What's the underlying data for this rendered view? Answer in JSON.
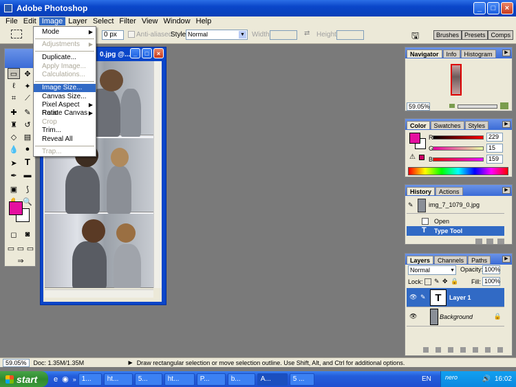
{
  "window": {
    "title": "Adobe Photoshop",
    "min": "_",
    "max": "□",
    "close": "×"
  },
  "menubar": [
    "File",
    "Edit",
    "Image",
    "Layer",
    "Select",
    "Filter",
    "View",
    "Window",
    "Help"
  ],
  "options": {
    "feather_value": "0 px",
    "anti_aliased": "Anti-aliased",
    "style_label": "Style:",
    "style_value": "Normal",
    "width_label": "Width:",
    "height_label": "Height:"
  },
  "palette_well": [
    "Brushes",
    "Presets",
    "Comps"
  ],
  "image_menu": {
    "items": [
      {
        "label": "Mode",
        "sub": true,
        "disabled": false
      },
      {
        "label": "Adjustments",
        "sub": true,
        "disabled": true
      },
      {
        "label": "Duplicate...",
        "sub": false,
        "disabled": false
      },
      {
        "label": "Apply Image...",
        "sub": false,
        "disabled": true
      },
      {
        "label": "Calculations...",
        "sub": false,
        "disabled": true
      },
      {
        "label": "Image Size...",
        "sub": false,
        "disabled": false,
        "highlighted": true
      },
      {
        "label": "Canvas Size...",
        "sub": false,
        "disabled": false
      },
      {
        "label": "Pixel Aspect Ratio",
        "sub": true,
        "disabled": false
      },
      {
        "label": "Rotate Canvas",
        "sub": true,
        "disabled": false
      },
      {
        "label": "Crop",
        "sub": false,
        "disabled": true
      },
      {
        "label": "Trim...",
        "sub": false,
        "disabled": false
      },
      {
        "label": "Reveal All",
        "sub": false,
        "disabled": false
      },
      {
        "label": "Trap...",
        "sub": false,
        "disabled": true
      }
    ]
  },
  "document": {
    "title": "0.jpg @..."
  },
  "navigator": {
    "tabs": [
      "Navigator",
      "Info",
      "Histogram"
    ],
    "zoom": "59.05%"
  },
  "color": {
    "tabs": [
      "Color",
      "Swatches",
      "Styles"
    ],
    "r_label": "R",
    "g_label": "G",
    "b_label": "B",
    "r": "229",
    "g": "15",
    "b": "159",
    "foreground": "#e50f9f"
  },
  "history": {
    "tabs": [
      "History",
      "Actions"
    ],
    "snapshot": "img_7_1079_0.jpg",
    "items": [
      "Open",
      "Type Tool"
    ]
  },
  "layers": {
    "tabs": [
      "Layers",
      "Channels",
      "Paths"
    ],
    "blend": "Normal",
    "opacity_label": "Opacity:",
    "opacity": "100%",
    "lock_label": "Lock:",
    "fill_label": "Fill:",
    "fill": "100%",
    "items": [
      {
        "name": "Layer 1",
        "thumb": "T",
        "selected": true
      },
      {
        "name": "Background",
        "thumb": "",
        "selected": false
      }
    ]
  },
  "status": {
    "zoom": "59.05%",
    "doc": "Doc: 1.35M/1.35M",
    "hint": "Draw rectangular selection or move selection outline.  Use Shift, Alt, and Ctrl for additional options."
  },
  "taskbar": {
    "start": "start",
    "tasks": [
      "1...",
      "ht...",
      "5...",
      "ht...",
      "P...",
      "b...",
      "A...",
      "5 ..."
    ],
    "lang": "EN",
    "nero": "nero",
    "clock": "16:02"
  }
}
